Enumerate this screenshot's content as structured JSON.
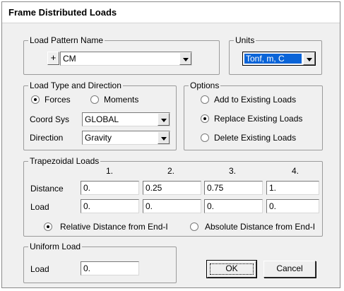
{
  "window": {
    "title": "Frame Distributed Loads"
  },
  "load_pattern": {
    "group_label": "Load Pattern Name",
    "add_label": "+",
    "value": "CM"
  },
  "units": {
    "group_label": "Units",
    "value": "Tonf, m, C"
  },
  "load_type": {
    "group_label": "Load Type and Direction",
    "forces_label": "Forces",
    "moments_label": "Moments",
    "selected": "Forces",
    "coord_sys_label": "Coord Sys",
    "coord_sys_value": "GLOBAL",
    "direction_label": "Direction",
    "direction_value": "Gravity"
  },
  "options": {
    "group_label": "Options",
    "add_label": "Add to Existing Loads",
    "replace_label": "Replace Existing Loads",
    "delete_label": "Delete Existing Loads",
    "selected": "Replace Existing Loads"
  },
  "trapezoidal": {
    "group_label": "Trapezoidal Loads",
    "columns": [
      "1.",
      "2.",
      "3.",
      "4."
    ],
    "distance_label": "Distance",
    "load_label": "Load",
    "distances": [
      "0.",
      "0.25",
      "0.75",
      "1."
    ],
    "loads": [
      "0.",
      "0.",
      "0.",
      "0."
    ],
    "relative_label": "Relative Distance from End-I",
    "absolute_label": "Absolute Distance from End-I",
    "selected": "Relative Distance from End-I"
  },
  "uniform": {
    "group_label": "Uniform Load",
    "load_label": "Load",
    "value": "0."
  },
  "buttons": {
    "ok_label": "OK",
    "cancel_label": "Cancel"
  },
  "colors": {
    "selection": "#0a64d8",
    "background": "#f0f0f0"
  }
}
